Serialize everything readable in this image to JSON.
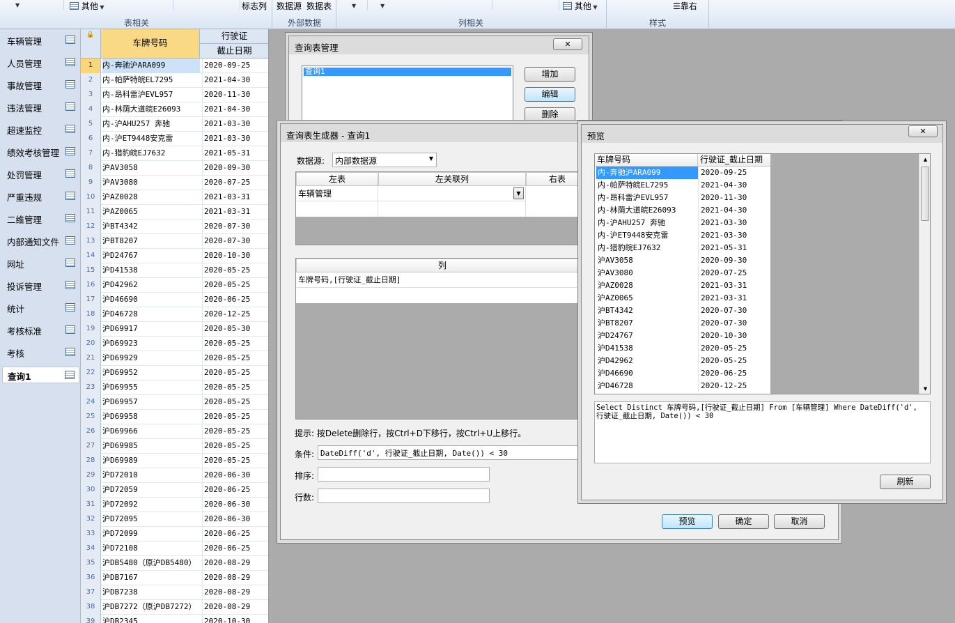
{
  "ribbon": {
    "other1": "其他",
    "flag_col": "标志列",
    "datasource": "数据源",
    "datatable": "数据表",
    "other2": "其他",
    "align_right": "靠右",
    "groups": [
      "表相关",
      "外部数据",
      "列相关",
      "样式"
    ]
  },
  "sidebar": {
    "items": [
      "车辆管理",
      "人员管理",
      "事故管理",
      "违法管理",
      "超速监控",
      "绩效考核管理",
      "处罚管理",
      "严重违规",
      "二维管理",
      "内部通知文件",
      "网址",
      "投诉管理",
      "统计",
      "考核标准",
      "考核",
      "查询1"
    ],
    "active_index": 15
  },
  "grid": {
    "headers": {
      "plate": "车牌号码",
      "license": "行驶证",
      "expiry": "截止日期"
    },
    "rows": [
      {
        "n": "1",
        "plate": "内-奔驰沪ARA099",
        "date": "2020-09-25"
      },
      {
        "n": "2",
        "plate": "内-帕萨特皖EL7295",
        "date": "2021-04-30"
      },
      {
        "n": "3",
        "plate": "内-昂科雷沪EVL957",
        "date": "2020-11-30"
      },
      {
        "n": "4",
        "plate": "内-林荫大道皖E26093",
        "date": "2021-04-30"
      },
      {
        "n": "5",
        "plate": "内-沪AHU257 奔驰",
        "date": "2021-03-30"
      },
      {
        "n": "6",
        "plate": "内-沪ET9448安克雷",
        "date": "2021-03-30"
      },
      {
        "n": "7",
        "plate": "内-猎豹皖EJ7632",
        "date": "2021-05-31"
      },
      {
        "n": "8",
        "plate": "沪AV3058",
        "date": "2020-09-30"
      },
      {
        "n": "9",
        "plate": "沪AV3080",
        "date": "2020-07-25"
      },
      {
        "n": "10",
        "plate": "沪AZ0028",
        "date": "2021-03-31"
      },
      {
        "n": "11",
        "plate": "沪AZ0065",
        "date": "2021-03-31"
      },
      {
        "n": "12",
        "plate": "沪BT4342",
        "date": "2020-07-30"
      },
      {
        "n": "13",
        "plate": "沪BT8207",
        "date": "2020-07-30"
      },
      {
        "n": "14",
        "plate": "沪D24767",
        "date": "2020-10-30"
      },
      {
        "n": "15",
        "plate": "沪D41538",
        "date": "2020-05-25"
      },
      {
        "n": "16",
        "plate": "沪D42962",
        "date": "2020-05-25"
      },
      {
        "n": "17",
        "plate": "沪D46690",
        "date": "2020-06-25"
      },
      {
        "n": "18",
        "plate": "沪D46728",
        "date": "2020-12-25"
      },
      {
        "n": "19",
        "plate": "沪D69917",
        "date": "2020-05-30"
      },
      {
        "n": "20",
        "plate": "沪D69923",
        "date": "2020-05-25"
      },
      {
        "n": "21",
        "plate": "沪D69929",
        "date": "2020-05-25"
      },
      {
        "n": "22",
        "plate": "沪D69952",
        "date": "2020-05-25"
      },
      {
        "n": "23",
        "plate": "沪D69955",
        "date": "2020-05-25"
      },
      {
        "n": "24",
        "plate": "沪D69957",
        "date": "2020-05-25"
      },
      {
        "n": "25",
        "plate": "沪D69958",
        "date": "2020-05-25"
      },
      {
        "n": "26",
        "plate": "沪D69966",
        "date": "2020-05-25"
      },
      {
        "n": "27",
        "plate": "沪D69985",
        "date": "2020-05-25"
      },
      {
        "n": "28",
        "plate": "沪D69989",
        "date": "2020-05-25"
      },
      {
        "n": "29",
        "plate": "沪D72010",
        "date": "2020-06-30"
      },
      {
        "n": "30",
        "plate": "沪D72059",
        "date": "2020-06-25"
      },
      {
        "n": "31",
        "plate": "沪D72092",
        "date": "2020-06-30"
      },
      {
        "n": "32",
        "plate": "沪D72095",
        "date": "2020-06-30"
      },
      {
        "n": "33",
        "plate": "沪D72099",
        "date": "2020-06-25"
      },
      {
        "n": "34",
        "plate": "沪D72108",
        "date": "2020-06-25"
      },
      {
        "n": "35",
        "plate": "沪DB5480（原沪DB5480）",
        "date": "2020-08-29"
      },
      {
        "n": "36",
        "plate": "沪DB7167",
        "date": "2020-08-29"
      },
      {
        "n": "37",
        "plate": "沪DB7238",
        "date": "2020-08-29"
      },
      {
        "n": "38",
        "plate": "沪DB7272（原沪DB7272）",
        "date": "2020-08-29"
      },
      {
        "n": "39",
        "plate": "沪DB2345",
        "date": "2020-10-30"
      }
    ]
  },
  "query_mgr": {
    "title": "查询表管理",
    "list": [
      "查询1"
    ],
    "add": "增加",
    "edit": "编辑",
    "delete": "删除"
  },
  "builder": {
    "title": "查询表生成器 - 查询1",
    "datasource_label": "数据源:",
    "datasource_value": "内部数据源",
    "col_left_table": "左表",
    "col_left_join": "左关联列",
    "col_right_table": "右表",
    "left_table_value": "车辆管理",
    "columns_header": "列",
    "columns_value": "车牌号码,[行驶证_截止日期]",
    "hint": "提示: 按Delete删除行，按Ctrl+D下移行，按Ctrl+U上移行。",
    "condition_label": "条件:",
    "condition_value": "DateDiff('d', 行驶证_截止日期, Date()) < 30",
    "sort_label": "排序:",
    "rows_label": "行数:",
    "preview": "预览",
    "ok": "确定",
    "cancel": "取消"
  },
  "preview": {
    "title": "预览",
    "headers": [
      "车牌号码",
      "行驶证_截止日期"
    ],
    "rows": [
      [
        "内-奔驰沪ARA099",
        "2020-09-25"
      ],
      [
        "内-帕萨特皖EL7295",
        "2021-04-30"
      ],
      [
        "内-昂科雷沪EVL957",
        "2020-11-30"
      ],
      [
        "内-林荫大道皖E26093",
        "2021-04-30"
      ],
      [
        "内-沪AHU257 奔驰",
        "2021-03-30"
      ],
      [
        "内-沪ET9448安克雷",
        "2021-03-30"
      ],
      [
        "内-猎豹皖EJ7632",
        "2021-05-31"
      ],
      [
        "沪AV3058",
        "2020-09-30"
      ],
      [
        "沪AV3080",
        "2020-07-25"
      ],
      [
        "沪AZ0028",
        "2021-03-31"
      ],
      [
        "沪AZ0065",
        "2021-03-31"
      ],
      [
        "沪BT4342",
        "2020-07-30"
      ],
      [
        "沪BT8207",
        "2020-07-30"
      ],
      [
        "沪D24767",
        "2020-10-30"
      ],
      [
        "沪D41538",
        "2020-05-25"
      ],
      [
        "沪D42962",
        "2020-05-25"
      ],
      [
        "沪D46690",
        "2020-06-25"
      ],
      [
        "沪D46728",
        "2020-12-25"
      ]
    ],
    "sql": "Select Distinct  车牌号码,[行驶证_截止日期] From [车辆管理] Where DateDiff('d', 行驶证_截止日期, Date()) < 30",
    "refresh": "刷新"
  }
}
